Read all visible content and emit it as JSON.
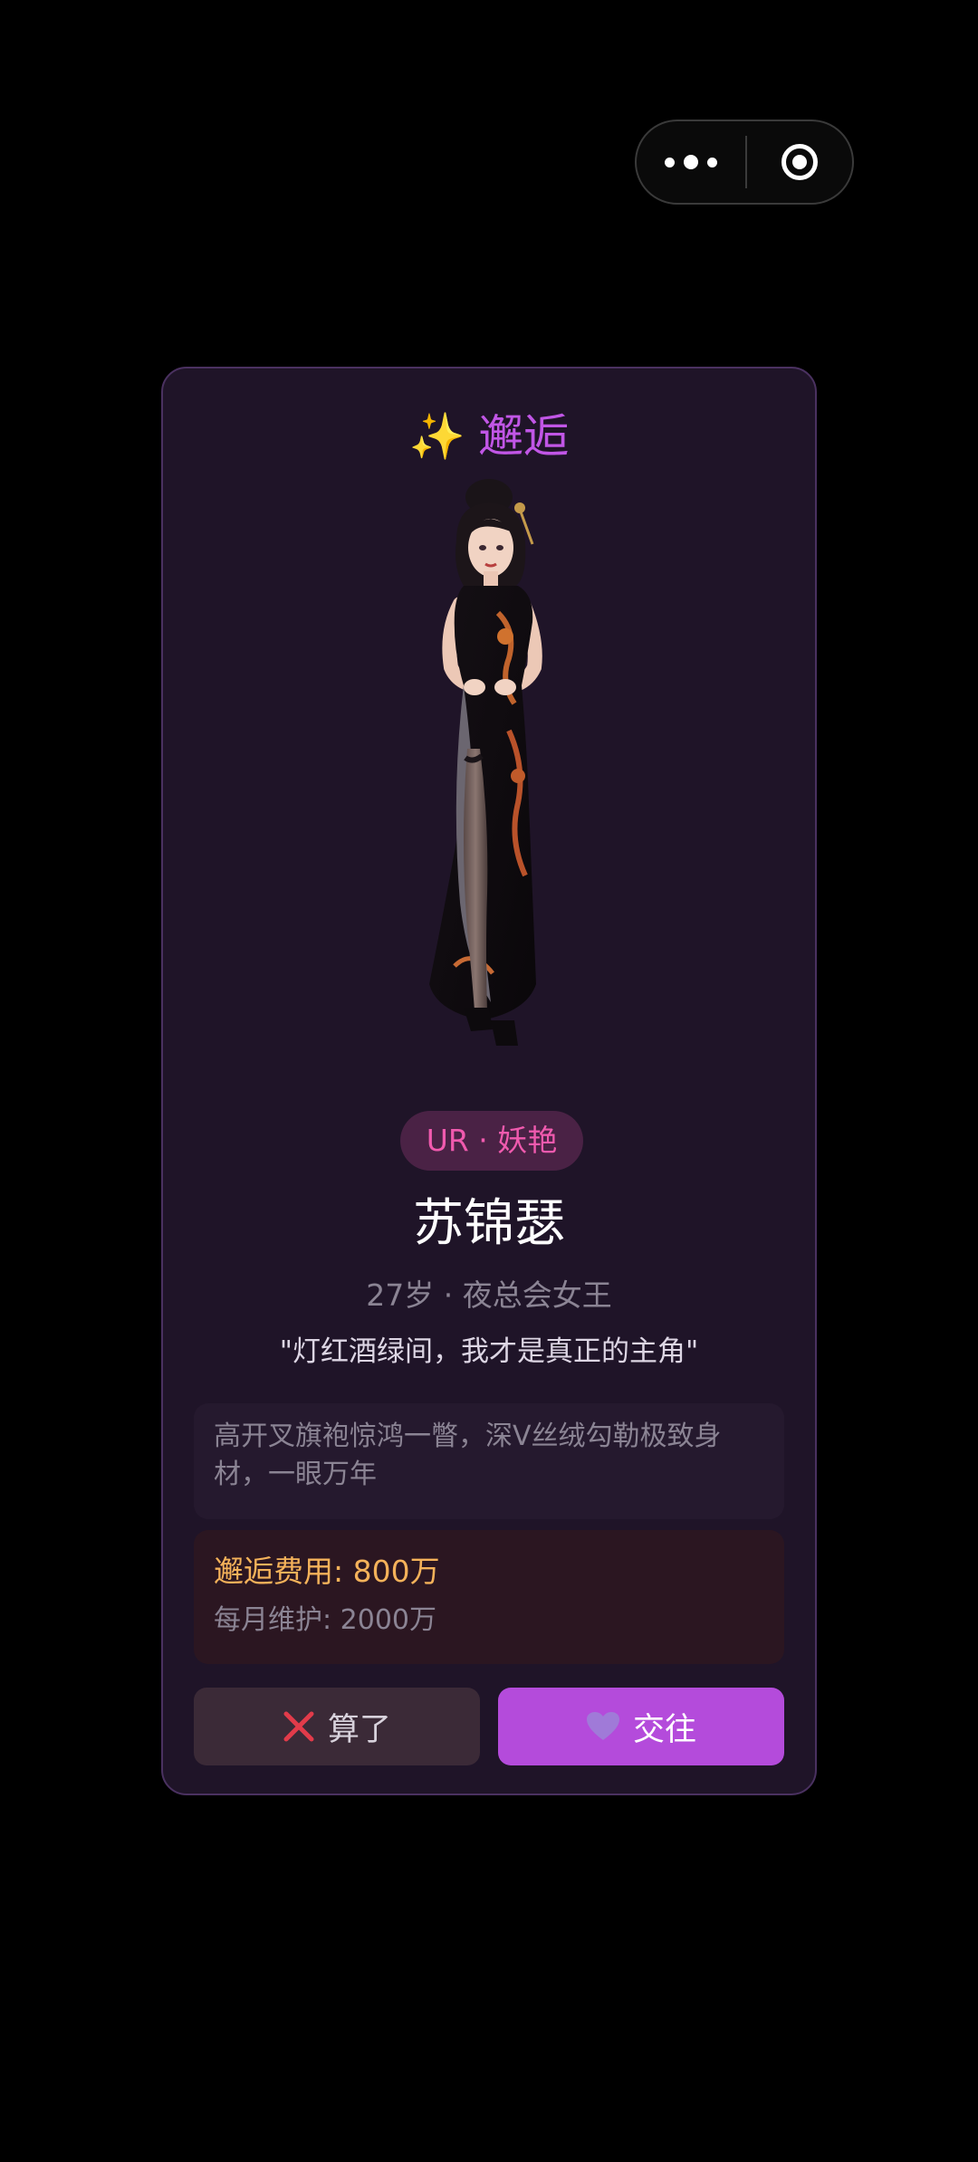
{
  "capsule": {
    "more_icon": "more-dots-icon",
    "close_icon": "target-close-icon"
  },
  "card": {
    "title_icon": "sparkles-icon",
    "title_sparkle": "✨",
    "title": "邂逅",
    "rarity": "UR · 妖艳",
    "name": "苏锦瑟",
    "meta": "27岁 · 夜总会女王",
    "quote": "\"灯红酒绿间，我才是真正的主角\"",
    "description": "高开叉旗袍惊鸿一瞥，深V丝绒勾勒极致身材，一眼万年",
    "cost": {
      "fee": "邂逅费用: 800万",
      "upkeep": "每月维护: 2000万"
    },
    "buttons": {
      "decline_label": "算了",
      "decline_icon": "cross-mark-icon",
      "accept_label": "交往",
      "accept_icon": "purple-heart-icon"
    }
  },
  "colors": {
    "background": "#000000",
    "card_bg": "#1f1428",
    "accent_purple": "#c156e6",
    "accept_button": "#b44bdb",
    "rarity_pink": "#f05aae",
    "fee_gold": "#f4b25a",
    "decline_red": "#e23b4a"
  }
}
